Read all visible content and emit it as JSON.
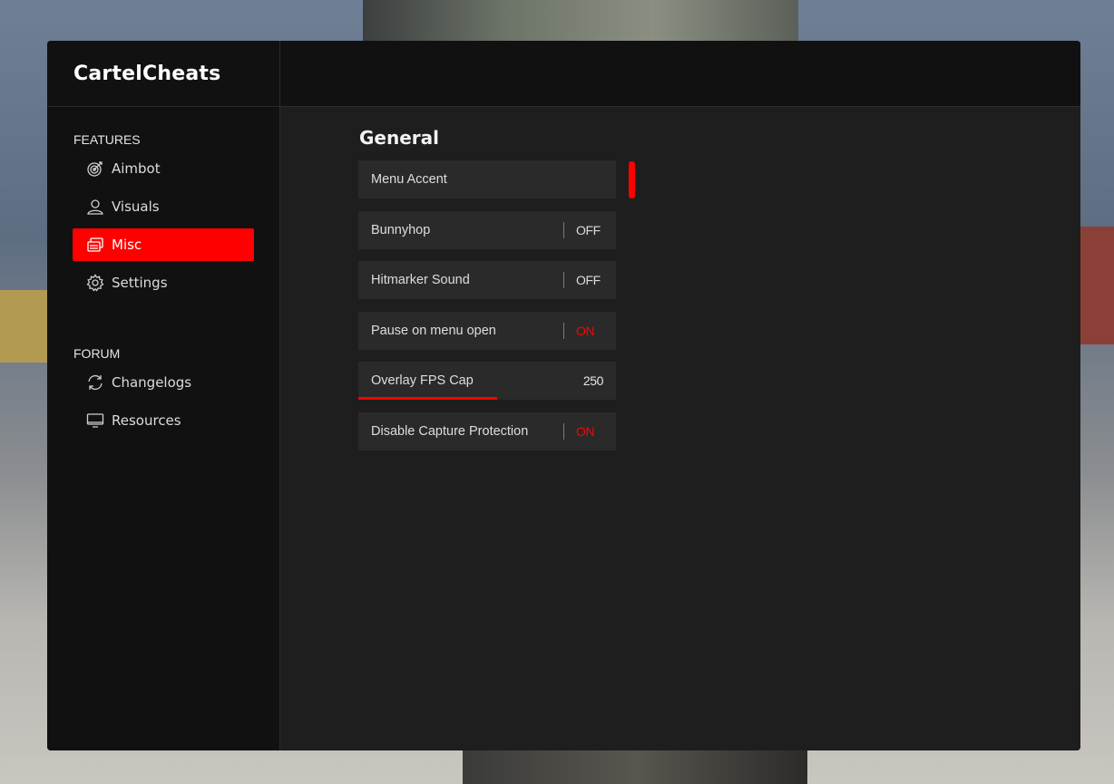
{
  "app": {
    "title": "CartelCheats"
  },
  "sidebar": {
    "sections": [
      {
        "title": "FEATURES",
        "items": [
          {
            "label": "Aimbot",
            "icon": "target-icon"
          },
          {
            "label": "Visuals",
            "icon": "user-icon"
          },
          {
            "label": "Misc",
            "icon": "layers-icon",
            "active": true
          },
          {
            "label": "Settings",
            "icon": "gear-icon"
          }
        ]
      },
      {
        "title": "FORUM",
        "items": [
          {
            "label": "Changelogs",
            "icon": "refresh-icon"
          },
          {
            "label": "Resources",
            "icon": "monitor-icon"
          }
        ]
      }
    ]
  },
  "main": {
    "group_title": "General",
    "options": {
      "menu_accent": {
        "label": "Menu Accent",
        "color": "#ff0000"
      },
      "bunnyhop": {
        "label": "Bunnyhop",
        "state": "OFF"
      },
      "hitmarker": {
        "label": "Hitmarker Sound",
        "state": "OFF"
      },
      "pause": {
        "label": "Pause on menu open",
        "state": "ON"
      },
      "fps_cap": {
        "label": "Overlay FPS Cap",
        "value": "250",
        "fill_fraction": 0.54
      },
      "capture": {
        "label": "Disable Capture Protection",
        "state": "ON"
      }
    }
  },
  "colors": {
    "accent": "#ff0000",
    "panel": "#1b1b1b",
    "sidebar": "#111111",
    "row": "#2a2a2a"
  }
}
